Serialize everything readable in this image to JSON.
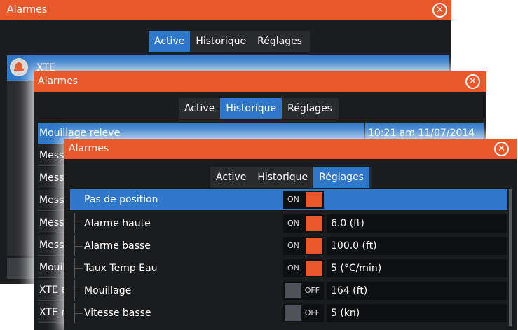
{
  "windows": {
    "back": {
      "title": "Alarmes",
      "tabs": [
        "Active",
        "Historique",
        "Réglages"
      ],
      "active_tab": "Active",
      "rows": [
        {
          "label": "XTE"
        }
      ]
    },
    "middle": {
      "title": "Alarmes",
      "tabs": [
        "Active",
        "Historique",
        "Réglages"
      ],
      "active_tab": "Historique",
      "rows": [
        {
          "label": "Mouillage releve",
          "time": "10:21 am 11/07/2014"
        },
        {
          "label": "Messa"
        },
        {
          "label": "Messa"
        },
        {
          "label": "Messa"
        },
        {
          "label": "Messa"
        },
        {
          "label": "Messa"
        },
        {
          "label": "Mouil"
        },
        {
          "label": "XTE e"
        },
        {
          "label": "XTE r"
        }
      ]
    },
    "front": {
      "title": "Alarmes",
      "tabs": [
        "Active",
        "Historique",
        "Réglages"
      ],
      "active_tab": "Réglages",
      "settings": [
        {
          "label": "Pas de position",
          "state": "ON",
          "value": ""
        },
        {
          "label": "Alarme haute",
          "state": "ON",
          "value": "6.0 (ft)"
        },
        {
          "label": "Alarme basse",
          "state": "ON",
          "value": "100.0 (ft)"
        },
        {
          "label": "Taux Temp Eau",
          "state": "ON",
          "value": "5 (°C/min)"
        },
        {
          "label": "Mouillage",
          "state": "OFF",
          "value": "164 (ft)"
        },
        {
          "label": "Vitesse basse",
          "state": "OFF",
          "value": "5 (kn)"
        }
      ]
    }
  },
  "colors": {
    "titlebar": "#e8582a",
    "accent": "#2e77c9",
    "panel": "#1b1c1e"
  },
  "icons": {
    "close": "close-icon",
    "bell": "bell-icon"
  }
}
